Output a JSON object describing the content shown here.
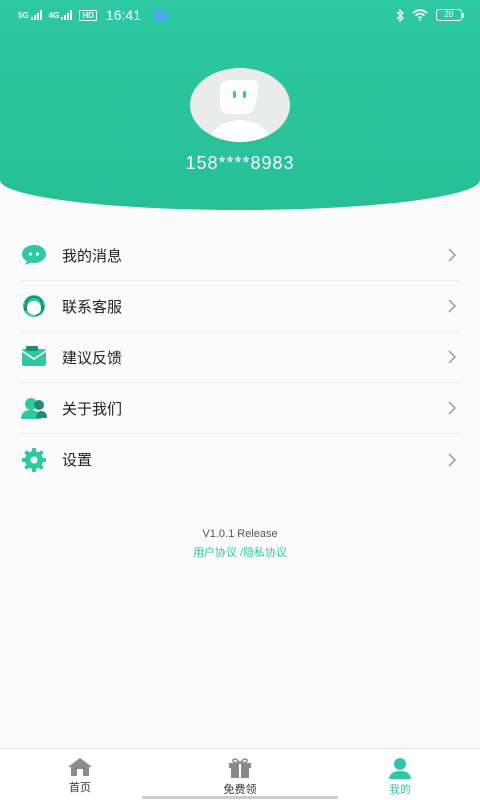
{
  "status_bar": {
    "net1": "5G",
    "net2": "4G",
    "hd": "HD",
    "time": "16:41",
    "battery": "20"
  },
  "profile": {
    "phone": "158****8983"
  },
  "menu": {
    "items": [
      {
        "label": "我的消息",
        "icon": "message-icon"
      },
      {
        "label": "联系客服",
        "icon": "customer-service-icon"
      },
      {
        "label": "建议反馈",
        "icon": "feedback-icon"
      },
      {
        "label": "关于我们",
        "icon": "about-us-icon"
      },
      {
        "label": "设置",
        "icon": "settings-icon"
      }
    ]
  },
  "footer": {
    "version": "V1.0.1 Release",
    "user_agreement": "用户协议",
    "separator": " /",
    "privacy_agreement": "隐私协议"
  },
  "bottom_nav": {
    "items": [
      {
        "label": "首页",
        "icon": "home-icon"
      },
      {
        "label": "免费领",
        "icon": "gift-icon"
      },
      {
        "label": "我的",
        "icon": "user-icon",
        "active": true
      }
    ]
  },
  "colors": {
    "accent": "#2ec9a1",
    "header": "#27bf96"
  }
}
